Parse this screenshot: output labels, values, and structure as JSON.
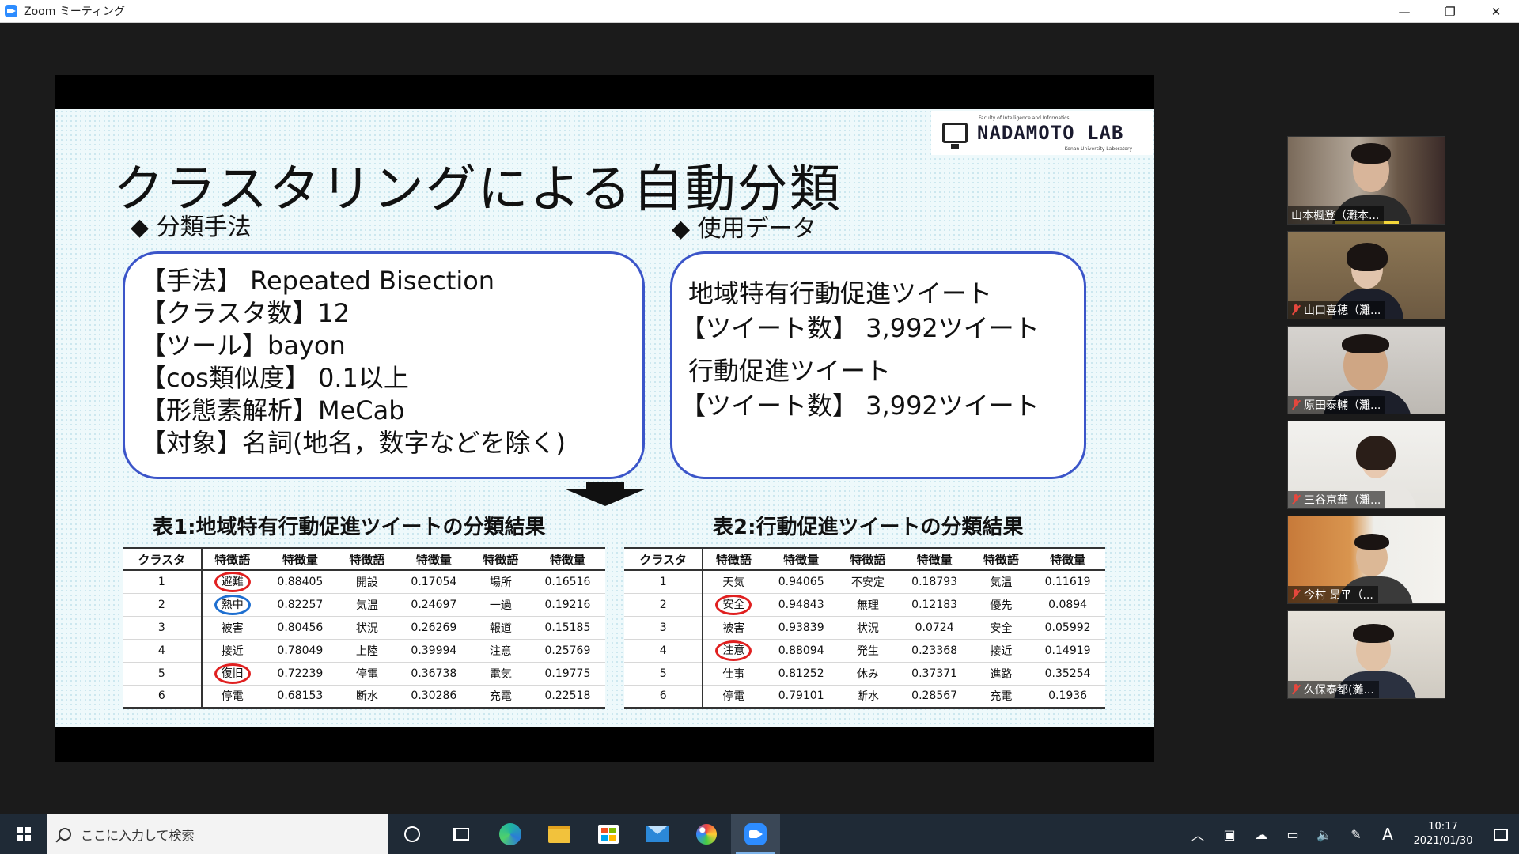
{
  "window": {
    "title": "Zoom ミーティング",
    "controls": {
      "minimize": "—",
      "restore": "❐",
      "close": "✕"
    }
  },
  "slide": {
    "logo": {
      "name": "NADAMOTO LAB",
      "sub": "Faculty of Intelligence and Informatics",
      "sub2": "Konan University Laboratory"
    },
    "title": "クラスタリングによる自動分類",
    "left_heading": "◆ 分類手法",
    "right_heading": "◆ 使用データ",
    "method_lines": [
      "【手法】 Repeated Bisection",
      "【クラスタ数】12",
      "【ツール】bayon",
      "【cos類似度】 0.1以上",
      "【形態素解析】MeCab",
      "【対象】名詞(地名，数字などを除く)"
    ],
    "data_lines": [
      "地域特有行動促進ツイート",
      "【ツイート数】 3,992ツイート",
      "行動促進ツイート",
      "【ツイート数】 3,992ツイート"
    ],
    "table1": {
      "caption": "表1:地域特有行動促進ツイートの分類結果",
      "headers": [
        "クラスタ",
        "特徴語",
        "特徴量",
        "特徴語",
        "特徴量",
        "特徴語",
        "特徴量"
      ],
      "rows": [
        [
          "1",
          "避難",
          "0.88405",
          "開設",
          "0.17054",
          "場所",
          "0.16516"
        ],
        [
          "2",
          "熱中",
          "0.82257",
          "気温",
          "0.24697",
          "一過",
          "0.19216"
        ],
        [
          "3",
          "被害",
          "0.80456",
          "状況",
          "0.26269",
          "報道",
          "0.15185"
        ],
        [
          "4",
          "接近",
          "0.78049",
          "上陸",
          "0.39994",
          "注意",
          "0.25769"
        ],
        [
          "5",
          "復旧",
          "0.72239",
          "停電",
          "0.36738",
          "電気",
          "0.19775"
        ],
        [
          "6",
          "停電",
          "0.68153",
          "断水",
          "0.30286",
          "充電",
          "0.22518"
        ]
      ]
    },
    "table2": {
      "caption": "表2:行動促進ツイートの分類結果",
      "headers": [
        "クラスタ",
        "特徴語",
        "特徴量",
        "特徴語",
        "特徴量",
        "特徴語",
        "特徴量"
      ],
      "rows": [
        [
          "1",
          "天気",
          "0.94065",
          "不安定",
          "0.18793",
          "気温",
          "0.11619"
        ],
        [
          "2",
          "安全",
          "0.94843",
          "無理",
          "0.12183",
          "優先",
          "0.0894"
        ],
        [
          "3",
          "被害",
          "0.93839",
          "状況",
          "0.0724",
          "安全",
          "0.05992"
        ],
        [
          "4",
          "注意",
          "0.88094",
          "発生",
          "0.23368",
          "接近",
          "0.14919"
        ],
        [
          "5",
          "仕事",
          "0.81252",
          "休み",
          "0.37371",
          "進路",
          "0.35254"
        ],
        [
          "6",
          "停電",
          "0.79101",
          "断水",
          "0.28567",
          "充電",
          "0.1936"
        ]
      ]
    },
    "highlight_colors": {
      "red": "#e02020",
      "blue": "#1e6fd0"
    }
  },
  "participants": [
    {
      "name": "山本楓登（灘本...",
      "muted": false
    },
    {
      "name": "山口喜穂（灘...",
      "muted": true
    },
    {
      "name": "原田泰輔（灘...",
      "muted": true
    },
    {
      "name": "三谷京華（灘...",
      "muted": true
    },
    {
      "name": "今村 昂平（...",
      "muted": true
    },
    {
      "name": "久保泰都(灘...",
      "muted": true
    }
  ],
  "taskbar": {
    "search_placeholder": "ここに入力して検索",
    "ime": "A",
    "time": "10:17",
    "date": "2021/01/30",
    "tray_chevron": "︿"
  }
}
